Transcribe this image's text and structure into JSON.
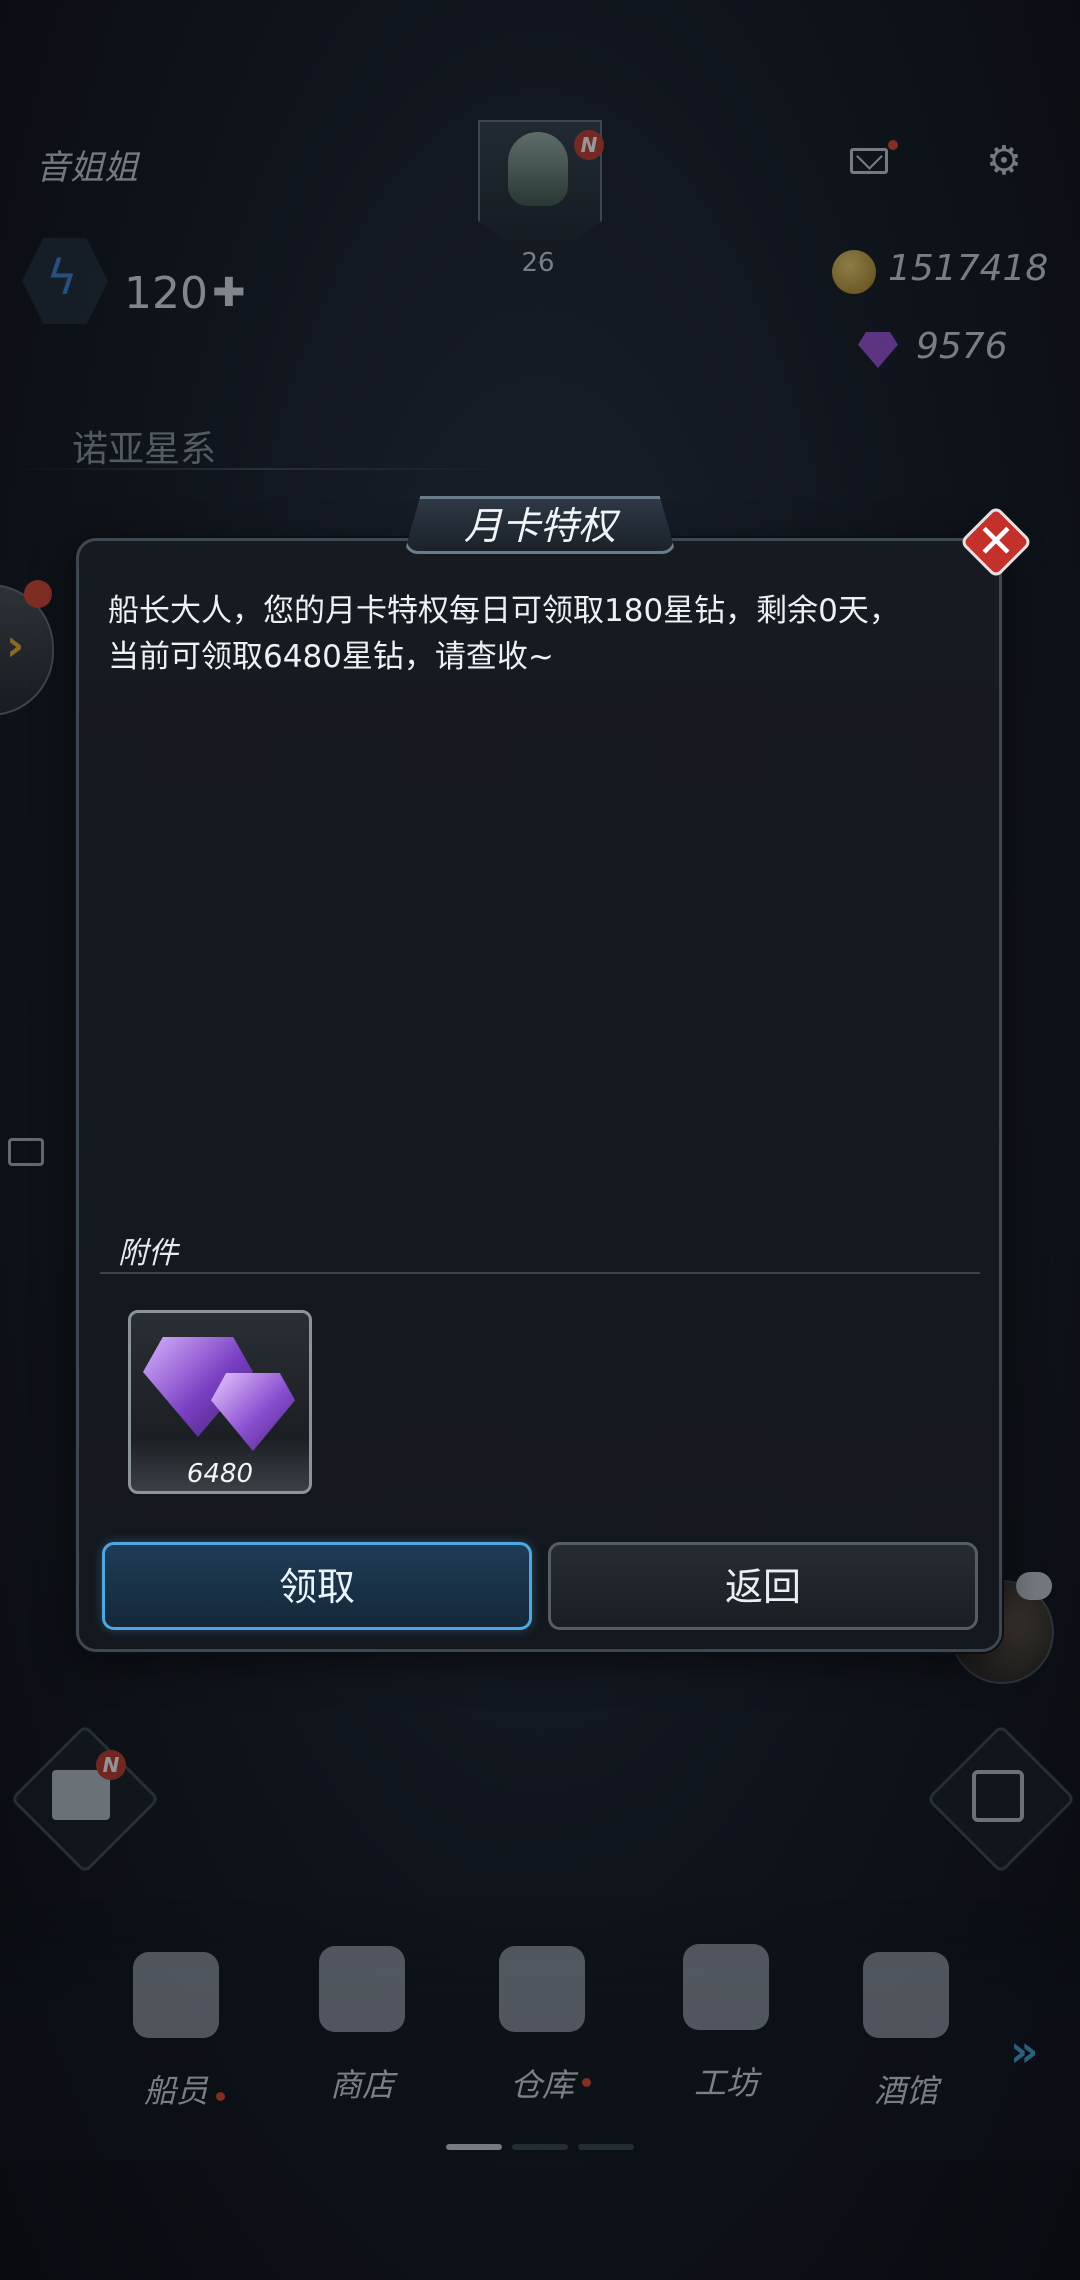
{
  "hud": {
    "username": "音姐姐",
    "player_level": "26",
    "new_badge": "N",
    "energy": "120",
    "coins": "1517418",
    "gems": "9576",
    "location": "诺亚星系"
  },
  "modal": {
    "title": "月卡特权",
    "message": "船长大人，您的月卡特权每日可领取180星钻，剩余0天，当前可领取6480星钻，请查收~",
    "attachment_label": "附件",
    "attachments": [
      {
        "name": "星钻",
        "icon": "purple-gem-icon",
        "quantity": "6480"
      }
    ],
    "claim_button": "领取",
    "back_button": "返回"
  },
  "bottom_nav": {
    "items": [
      {
        "label": "船员",
        "icon": "crew-icon",
        "has_dot": true
      },
      {
        "label": "商店",
        "icon": "shop-icon",
        "has_dot": false
      },
      {
        "label": "仓库",
        "icon": "warehouse-icon",
        "has_dot": true
      },
      {
        "label": "工坊",
        "icon": "workshop-icon",
        "has_dot": false
      },
      {
        "label": "酒馆",
        "icon": "tavern-icon",
        "has_dot": false
      }
    ]
  },
  "colors": {
    "accent_blue": "#4ea7e0",
    "close_red": "#c4302b",
    "notification_red": "#e0452e",
    "gem_purple": "#9c4fd6",
    "coin_gold": "#f3d56b"
  }
}
